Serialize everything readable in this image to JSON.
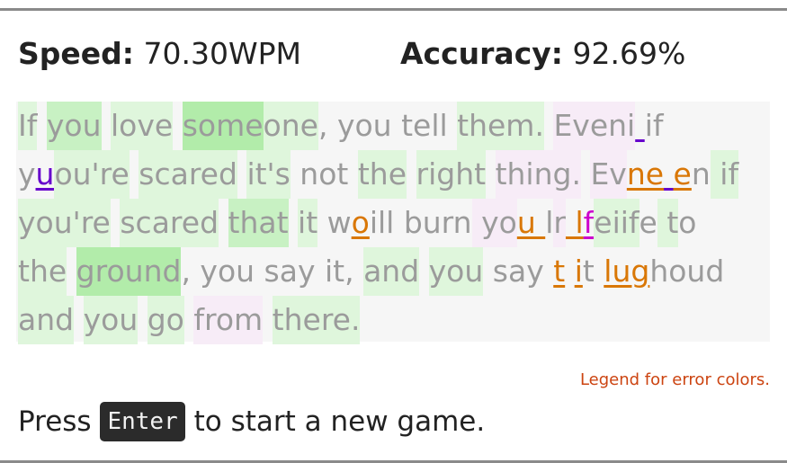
{
  "stats": {
    "speed_label": "Speed:",
    "speed_value": "70.30WPM",
    "accuracy_label": "Accuracy:",
    "accuracy_value": "92.69%"
  },
  "passage": {
    "lines": [
      "If you love someone, you tell them. Eveni if",
      "yuou're scared it's not the right thing. Evne en if",
      "you're scared that it woill burn you lr lfeiife to",
      "the ground, you say it, and you say t it lughoud",
      "and you go from there."
    ]
  },
  "legend": {
    "label": "Legend for error colors."
  },
  "footer": {
    "prefix": "Press",
    "key": "Enter",
    "suffix": "to start a new game."
  },
  "colors": {
    "correct_strong": "#b2ecaa",
    "correct_light": "#dff6dc",
    "slow_pink": "#f7ecf7",
    "error_purple": "#6600cc",
    "error_orange": "#d97706",
    "error_magenta": "#cc00cc",
    "legend_link": "#cc4411"
  }
}
